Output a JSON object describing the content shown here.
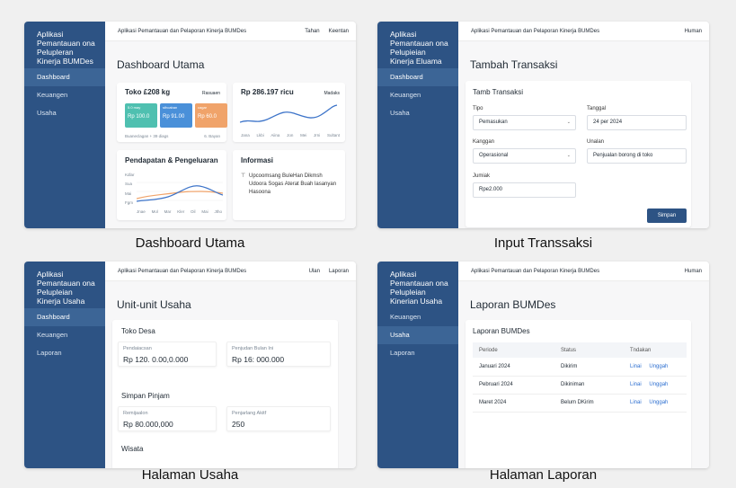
{
  "screens": {
    "dashboard": {
      "caption": "Dashboard Utama",
      "brand": "Aplikasi Pemantauan ona Pelupleran Kinerja BUMDes",
      "topbar": {
        "title": "Aplikasi Pemantauan dan Pelaporan Kinerja BUMDes",
        "links": [
          "Tahan",
          "Keentan"
        ]
      },
      "nav": [
        "Dashboard",
        "Keuangen",
        "Usaha"
      ],
      "page_title": "Dashboard Utama",
      "summary_card": {
        "title": "Toko £208 kg",
        "badge": "Rasuaen",
        "minis": [
          {
            "label": "5.0 may",
            "value": "Rp 100.0",
            "color": "#4fc0b0"
          },
          {
            "label": "sthcaban",
            "value": "Rp 91.00",
            "color": "#4a90d9"
          },
          {
            "label": "cagar",
            "value": "Rp 60.0",
            "color": "#f0a36a"
          }
        ],
        "footer_left": "Buaneclagan + 39 diags",
        "footer_right": "6. Bayan"
      },
      "trend_card": {
        "title": "Rp 286.197 ricu",
        "badge": "Madaks",
        "months": [
          "Jana",
          "Lkbi",
          "Aiina",
          "Jon",
          "Mei",
          "Jrni",
          "Sultant"
        ]
      },
      "income_card": {
        "title": "Pendapatan & Pengeluaran",
        "y_labels": [
          "Kdlar",
          "Sua",
          "Mai",
          "Fgm"
        ],
        "months": [
          "Jnae",
          "Mol",
          "Mar",
          "Kler",
          "Oil",
          "Mai",
          "Jtho"
        ]
      },
      "info_card": {
        "title": "Informasi",
        "text": "Upcoomsang BuleHan Dikmsh Udoora Sogas Aterat Buah lasanyan Hasoona"
      }
    },
    "transaksi": {
      "caption": "Input Transsaksi",
      "brand": "Aplikasi Pemantauan ona Pelupieian Kinerja Eluama",
      "topbar": {
        "title": "Aplikasi Pemantauan dan Pelaporan Kinerja BUMDes",
        "links": [
          "Human"
        ]
      },
      "nav": [
        "Dashboard",
        "Keuangen",
        "Usaha"
      ],
      "page_title": "Tambah Transaksi",
      "form_title": "Tamb Transaksi",
      "fields": {
        "tipe": {
          "label": "Tipo",
          "value": "Pemasukan"
        },
        "tanggal": {
          "label": "Tanggal",
          "value": "24 per 2024"
        },
        "kategori": {
          "label": "Kanggan",
          "value": "Operasional"
        },
        "uraian": {
          "label": "Unalan",
          "value": "Penjualan borong di toko"
        },
        "jumlah": {
          "label": "Jumiak",
          "value": "Rpe2.000"
        }
      },
      "submit": "Simpan"
    },
    "usaha": {
      "caption": "Halaman Usaha",
      "brand": "Aplikasi Pemantauan ona Pelupleian Kinerja Usaha",
      "topbar": {
        "title": "Aplikasi Pemantauan dan Pelaporan Kinerja BUMDes",
        "links": [
          "Ulan",
          "Laporan"
        ]
      },
      "nav": [
        "Dashboard",
        "Keuangen",
        "Laporan"
      ],
      "page_title": "Unit-unit Usaha",
      "units": [
        {
          "name": "Toko Desa",
          "stats": [
            {
              "label": "Pendaiacsan",
              "value": "Rp 120. 0.00,0.000"
            },
            {
              "label": "Penjudan Bulan Ini",
              "value": "Rp 16: 000.000"
            }
          ]
        },
        {
          "name": "Simpan Pinjam",
          "stats": [
            {
              "label": "Remijaalon",
              "value": "Rp 80.000,000"
            },
            {
              "label": "Penjarlang Akitf",
              "value": "250"
            }
          ]
        },
        {
          "name": "Wisata",
          "stats": []
        }
      ]
    },
    "laporan": {
      "caption": "Halaman Laporan",
      "brand": "Aplikasi Pemantauan ona Pelupleian Kinerian Usaha",
      "topbar": {
        "title": "Aplikasi Pemantauan dan Pelaporan Kinerja BUMDes",
        "links": [
          "Human"
        ]
      },
      "nav": [
        "Keuangen",
        "Usaha",
        "Laporan"
      ],
      "page_title": "Laporan BUMDes",
      "table_title": "Laporan BUMDes",
      "columns": [
        "Periode",
        "Status",
        "Tndakan"
      ],
      "rows": [
        {
          "periode": "Januari 2024",
          "status": "Dikirim",
          "a1": "Linai",
          "a2": "Unggah"
        },
        {
          "periode": "Pebruari 2024",
          "status": "Dikiniman",
          "a1": "Linai",
          "a2": "Unggah"
        },
        {
          "periode": "Maret 2024",
          "status": "Belum DKirim",
          "a1": "Linai",
          "a2": "Unggah"
        }
      ]
    }
  }
}
